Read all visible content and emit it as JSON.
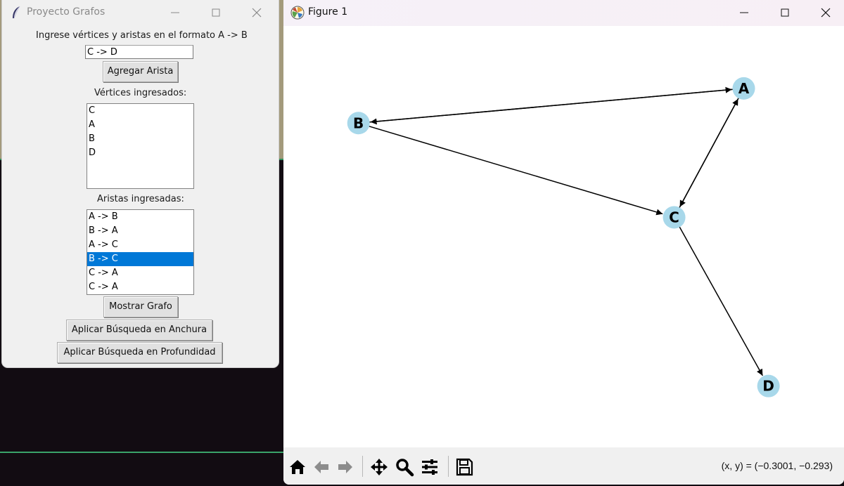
{
  "tk": {
    "title": "Proyecto Grafos",
    "instruction": "Ingrese vértices y aristas en el formato A -> B",
    "entry_value": "C -> D",
    "add_button": "Agregar Arista",
    "vertices_label": "Vértices ingresados:",
    "vertices": [
      "C",
      "A",
      "B",
      "D"
    ],
    "edges_label": "Aristas ingresadas:",
    "edges": [
      "A -> B",
      "B -> A",
      "A -> C",
      "B -> C",
      "C -> A",
      "C -> A"
    ],
    "selected_edge_index": 3,
    "show_button": "Mostrar Grafo",
    "bfs_button": "Aplicar Búsqueda en Anchura",
    "dfs_button": "Aplicar Búsqueda en Profundidad"
  },
  "figure": {
    "title": "Figure 1",
    "coords": "(x, y) = (−0.3001, −0.293)",
    "tools": [
      "home-icon",
      "back-icon",
      "forward-icon",
      "pan-icon",
      "zoom-icon",
      "configure-subplots-icon",
      "save-icon"
    ],
    "node_color": "#a8d8ea"
  },
  "chart_data": {
    "type": "diagram",
    "nodes": [
      {
        "id": "A",
        "label": "A",
        "x": 0.857,
        "y": 0.906
      },
      {
        "id": "B",
        "label": "B",
        "x": 0.093,
        "y": 0.811
      },
      {
        "id": "C",
        "label": "C",
        "x": 0.719,
        "y": 0.553
      },
      {
        "id": "D",
        "label": "D",
        "x": 0.906,
        "y": 0.091
      }
    ],
    "edges": [
      {
        "from": "A",
        "to": "B"
      },
      {
        "from": "B",
        "to": "A"
      },
      {
        "from": "A",
        "to": "C"
      },
      {
        "from": "B",
        "to": "C"
      },
      {
        "from": "C",
        "to": "A"
      },
      {
        "from": "C",
        "to": "D"
      }
    ]
  }
}
